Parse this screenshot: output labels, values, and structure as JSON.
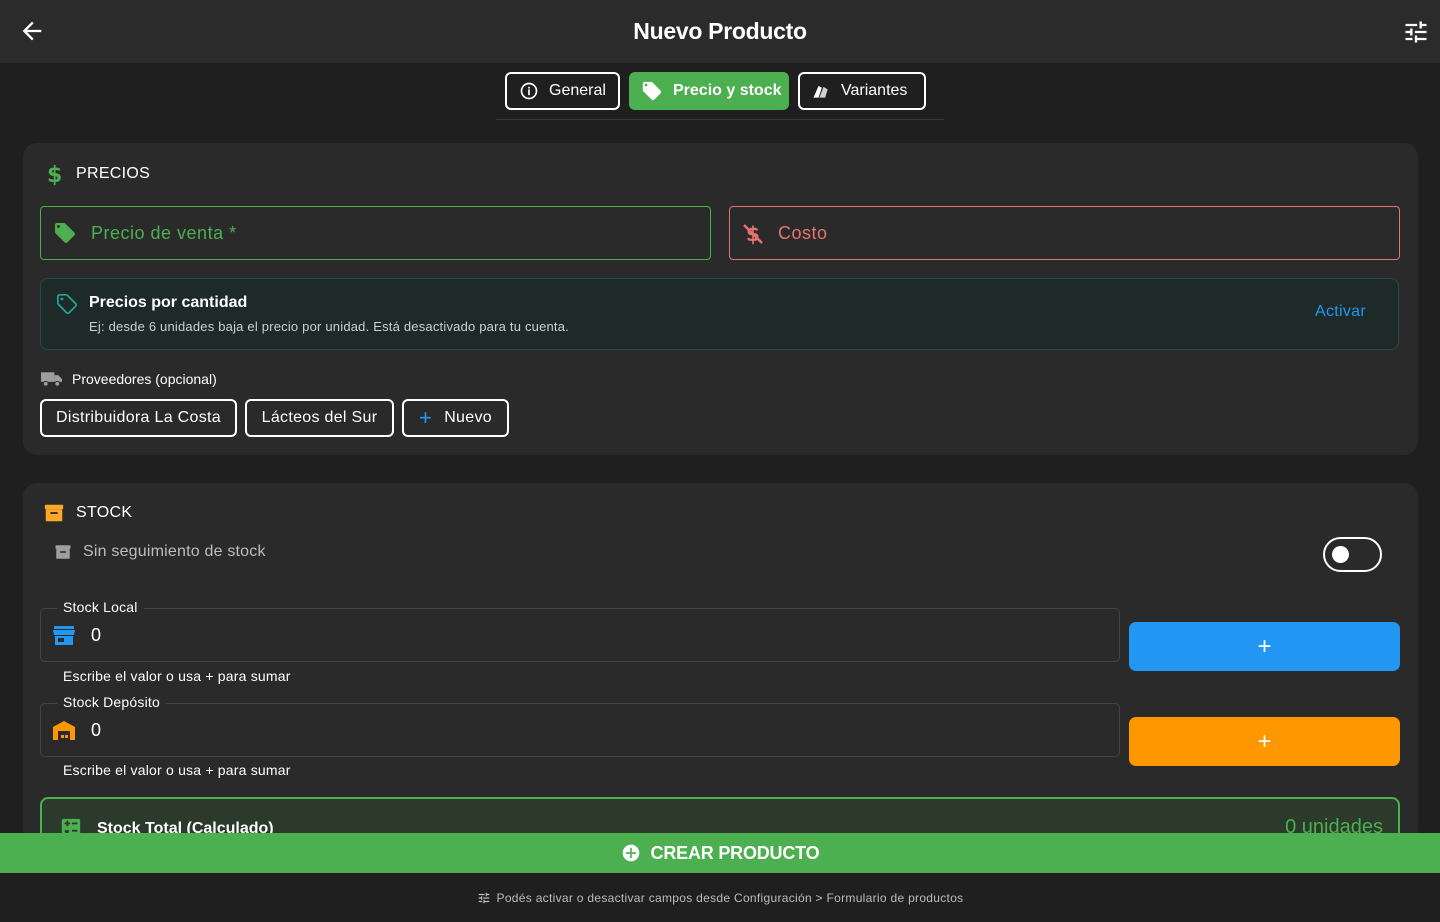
{
  "header": {
    "title": "Nuevo Producto"
  },
  "tabs": [
    {
      "label": "General",
      "icon": "info-icon"
    },
    {
      "label": "Precio y stock",
      "icon": "tag-icon",
      "active": true
    },
    {
      "label": "Variantes",
      "icon": "variants-icon"
    }
  ],
  "prices": {
    "section_title": "PRECIOS",
    "sale_placeholder": "Precio de venta *",
    "cost_placeholder": "Costo",
    "quantity_pricing": {
      "title": "Precios por cantidad",
      "subtitle": "Ej: desde 6 unidades baja el precio por unidad. Está desactivado para tu cuenta.",
      "action": "Activar"
    },
    "providers_label": "Proveedores (opcional)",
    "providers": [
      "Distribuidora La Costa",
      "Lácteos del Sur"
    ],
    "new_provider": "Nuevo"
  },
  "stock": {
    "section_title": "STOCK",
    "no_tracking": "Sin seguimiento de stock",
    "no_tracking_enabled": false,
    "local": {
      "label": "Stock Local",
      "value": "0",
      "helper": "Escribe el valor o usa + para sumar"
    },
    "deposit": {
      "label": "Stock Depósito",
      "value": "0",
      "helper": "Escribe el valor o usa + para sumar"
    },
    "add_symbol": "+",
    "total": {
      "label": "Stock Total (Calculado)",
      "value": "0 unidades"
    }
  },
  "actions": {
    "create": "CREAR PRODUCTO"
  },
  "footer": {
    "hint": "Podés activar o desactivar campos desde Configuración > Formulario de productos"
  },
  "colors": {
    "accent": "#4caf50",
    "cost": "#e57373",
    "link": "#2196f3",
    "deposit": "#ff9800",
    "stock_icon": "#ffa726"
  }
}
